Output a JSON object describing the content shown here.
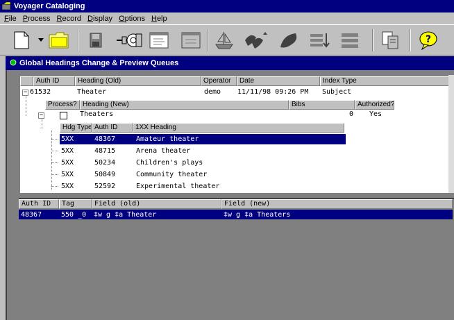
{
  "app": {
    "title": "Voyager Cataloging"
  },
  "menu": [
    {
      "label": "File",
      "acc": "F",
      "rest": "ile"
    },
    {
      "label": "Process",
      "acc": "P",
      "rest": "rocess"
    },
    {
      "label": "Record",
      "acc": "R",
      "rest": "ecord"
    },
    {
      "label": "Display",
      "acc": "D",
      "rest": "isplay"
    },
    {
      "label": "Options",
      "acc": "O",
      "rest": "ptions"
    },
    {
      "label": "Help",
      "acc": "H",
      "rest": "elp"
    }
  ],
  "toolbar": {
    "icons": [
      "new-document-icon",
      "dropdown-arrow-icon",
      "open-folder-icon",
      "save-icon",
      "network-connect-icon",
      "form-icon",
      "form-alt-icon",
      "ship-icon",
      "birds-arrow-icon",
      "bird-icon",
      "list-arrow-icon",
      "list-icon",
      "tree-document-icon",
      "help-balloon-icon"
    ]
  },
  "window": {
    "title": "Global Headings Change & Preview Queues"
  },
  "upper": {
    "headers": {
      "auth_id": "Auth ID",
      "heading_old": "Heading (Old)",
      "operator": "Operator",
      "date": "Date",
      "index_type": "Index Type"
    },
    "row": {
      "auth_id": "61532",
      "heading": "Theater",
      "operator": "demo",
      "date": "11/11/98 09:26 PM",
      "index_type": "Subject",
      "expander": "−"
    },
    "sub_headers": {
      "process": "Process?",
      "heading_new": "Heading (New)",
      "bibs": "Bibs",
      "authorized": "Authorized?"
    },
    "sub_row": {
      "heading": "Theaters",
      "bibs": "0",
      "authorized": "Yes",
      "expander": "−"
    },
    "inner_headers": {
      "hdg_type": "Hdg Type",
      "auth_id": "Auth ID",
      "heading": "1XX Heading"
    },
    "inner_rows": [
      {
        "type": "5XX",
        "auth_id": "48367",
        "heading": "Amateur theater"
      },
      {
        "type": "5XX",
        "auth_id": "48715",
        "heading": "Arena theater"
      },
      {
        "type": "5XX",
        "auth_id": "50234",
        "heading": "Children's plays"
      },
      {
        "type": "5XX",
        "auth_id": "50849",
        "heading": "Community theater"
      },
      {
        "type": "5XX",
        "auth_id": "52592",
        "heading": "Experimental theater"
      }
    ]
  },
  "lower": {
    "headers": {
      "auth_id": "Auth ID",
      "tag": "Tag",
      "field_old": "Field (old)",
      "field_new": "Field (new)"
    },
    "row": {
      "auth_id": "48367",
      "tag": "550 _0",
      "field_old": "‡w g ‡a Theater",
      "field_new": "‡w g ‡a Theaters"
    }
  },
  "colors": {
    "titlebar": "#000080",
    "selection": "#000080",
    "face": "#c0c0c0",
    "mdi": "#808080"
  }
}
